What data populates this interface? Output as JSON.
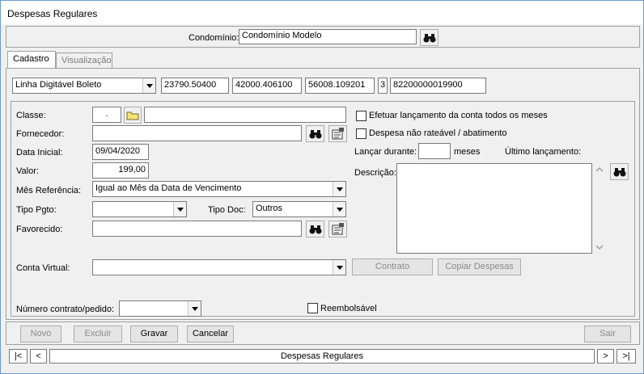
{
  "window": {
    "title": "Despesas Regulares"
  },
  "condominio": {
    "label": "Condomínio:",
    "value": "Condomínio Modelo"
  },
  "tabs": [
    {
      "label": "Cadastro"
    },
    {
      "label": "Visualização"
    }
  ],
  "barcode": {
    "type": "Linha Digitável Boleto",
    "field1": "23790.50400",
    "field2": "42000.406100",
    "field3": "56008.109201",
    "field4": "3",
    "field5": "82200000019900"
  },
  "form": {
    "classe_label": "Classe:",
    "classe_code": ".",
    "fornecedor_label": "Fornecedor:",
    "data_inicial_label": "Data Inicial:",
    "data_inicial_value": "09/04/2020",
    "valor_label": "Valor:",
    "valor_value": "199,00",
    "mes_ref_label": "Mês Referência:",
    "mes_ref_value": "Igual ao Mês da Data de Vencimento",
    "tipo_pgto_label": "Tipo Pgto:",
    "tipo_doc_label": "Tipo Doc:",
    "tipo_doc_value": "Outros",
    "favorecido_label": "Favorecido:",
    "conta_virtual_label": "Conta Virtual:",
    "numero_contrato_label": "Número contrato/pedido:",
    "efetuar_label": "Efetuar lançamento da conta todos os meses",
    "despesa_nao_rateavel_label": "Despesa não rateável / abatimento",
    "lancar_durante_label": "Lançar durante:",
    "meses_label": "meses",
    "ultimo_lancamento_label": "Último lançamento:",
    "descricao_label": "Descrição:",
    "reembolsavel_label": "Reembolsável",
    "contrato_button": "Contrato",
    "copiar_despesas_button": "Copiar Despesas"
  },
  "actions": {
    "novo": "Novo",
    "excluir": "Excluir",
    "gravar": "Gravar",
    "cancelar": "Cancelar",
    "sair": "Sair"
  },
  "navigator": {
    "first": "|<",
    "prev": "<",
    "caption": "Despesas Regulares",
    "next": ">",
    "last": ">|"
  }
}
